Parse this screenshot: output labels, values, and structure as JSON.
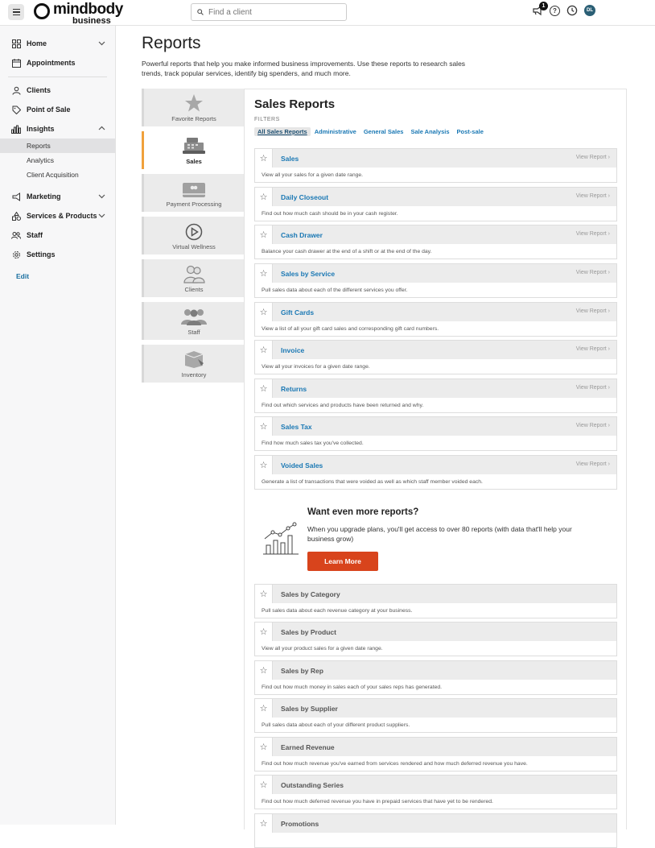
{
  "topbar": {
    "logo_main": "mindbody",
    "logo_sub": "business",
    "search_placeholder": "Find a client",
    "notification_count": "1",
    "help_glyph": "?",
    "avatar_initials": "DL"
  },
  "sidebar": {
    "home": "Home",
    "appointments": "Appointments",
    "clients": "Clients",
    "point_of_sale": "Point of Sale",
    "insights": "Insights",
    "insights_sub": [
      "Reports",
      "Analytics",
      "Client Acquisition"
    ],
    "marketing": "Marketing",
    "services_products": "Services & Products",
    "staff": "Staff",
    "settings": "Settings",
    "edit": "Edit"
  },
  "page": {
    "title": "Reports",
    "description": "Powerful reports that help you make informed business improvements. Use these reports to research sales trends, track popular services, identify big spenders, and much more."
  },
  "tabs": [
    "Favorite Reports",
    "Sales",
    "Payment Processing",
    "Virtual Wellness",
    "Clients",
    "Staff",
    "Inventory"
  ],
  "panel": {
    "title": "Sales Reports",
    "filters_label": "FILTERS",
    "filters": [
      "All Sales Reports",
      "Administrative",
      "General Sales",
      "Sale Analysis",
      "Post-sale"
    ],
    "view_report": "View Report",
    "reports": [
      {
        "name": "Sales",
        "desc": "View all your sales for a given date range."
      },
      {
        "name": "Daily Closeout",
        "desc": "Find out how much cash should be in your cash register."
      },
      {
        "name": "Cash Drawer",
        "desc": "Balance your cash drawer at the end of a shift or at the end of the day."
      },
      {
        "name": "Sales by Service",
        "desc": "Pull sales data about each of the different services you offer."
      },
      {
        "name": "Gift Cards",
        "desc": "View a list of all your gift card sales and corresponding gift card numbers."
      },
      {
        "name": "Invoice",
        "desc": "View all your invoices for a given date range."
      },
      {
        "name": "Returns",
        "desc": "Find out which services and products have been returned and why."
      },
      {
        "name": "Sales Tax",
        "desc": "Find how much sales tax you've collected."
      },
      {
        "name": "Voided Sales",
        "desc": "Generate a list of transactions that were voided as well as which staff member voided each."
      }
    ],
    "promo": {
      "title": "Want even more reports?",
      "text": "When you upgrade plans, you'll get access to over 80 reports (with data that'll help your business grow)",
      "button": "Learn More"
    },
    "locked_reports": [
      {
        "name": "Sales by Category",
        "desc": "Pull sales data about each revenue category at your business."
      },
      {
        "name": "Sales by Product",
        "desc": "View all your product sales for a given date range."
      },
      {
        "name": "Sales by Rep",
        "desc": "Find out how much money in sales each of your sales reps has generated."
      },
      {
        "name": "Sales by Supplier",
        "desc": "Pull sales data about each of your different product suppliers."
      },
      {
        "name": "Earned Revenue",
        "desc": "Find out how much revenue you've earned from services rendered and how much deferred revenue you have."
      },
      {
        "name": "Outstanding Series",
        "desc": "Find out how much deferred revenue you have in prepaid services that have yet to be rendered."
      },
      {
        "name": "Promotions",
        "desc": ""
      }
    ]
  },
  "colors": {
    "accent": "#1a78b4",
    "cta": "#d8441c",
    "active_tab": "#f0a13c"
  }
}
